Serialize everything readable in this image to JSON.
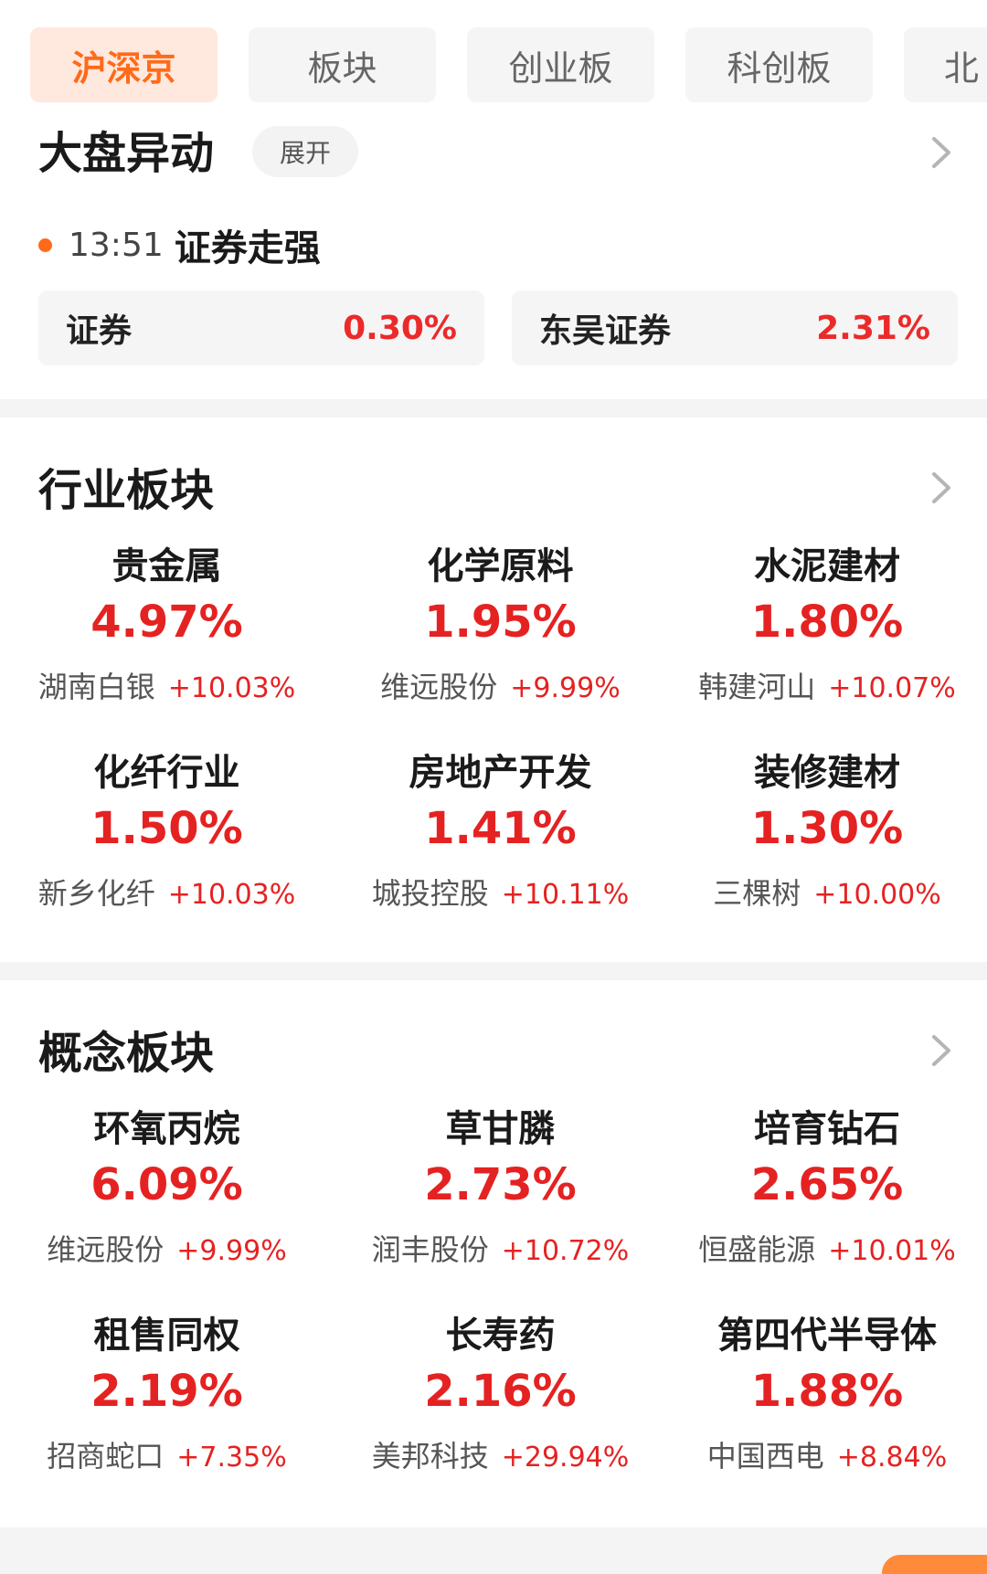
{
  "tabs": [
    {
      "label": "沪深京",
      "active": true
    },
    {
      "label": "板块",
      "active": false
    },
    {
      "label": "创业板",
      "active": false
    },
    {
      "label": "科创板",
      "active": false
    },
    {
      "label": "北",
      "active": false
    }
  ],
  "market_move": {
    "title": "大盘异动",
    "expand_label": "展开",
    "event_time": "13:51",
    "event_text": "证券走强",
    "chips": [
      {
        "name": "证券",
        "value": "0.30%"
      },
      {
        "name": "东吴证券",
        "value": "2.31%"
      }
    ]
  },
  "industry": {
    "title": "行业板块",
    "items": [
      {
        "name": "贵金属",
        "pct": "4.97%",
        "lead": "湖南白银",
        "lead_pct": "+10.03%"
      },
      {
        "name": "化学原料",
        "pct": "1.95%",
        "lead": "维远股份",
        "lead_pct": "+9.99%"
      },
      {
        "name": "水泥建材",
        "pct": "1.80%",
        "lead": "韩建河山",
        "lead_pct": "+10.07%"
      },
      {
        "name": "化纤行业",
        "pct": "1.50%",
        "lead": "新乡化纤",
        "lead_pct": "+10.03%"
      },
      {
        "name": "房地产开发",
        "pct": "1.41%",
        "lead": "城投控股",
        "lead_pct": "+10.11%"
      },
      {
        "name": "装修建材",
        "pct": "1.30%",
        "lead": "三棵树",
        "lead_pct": "+10.00%"
      }
    ]
  },
  "concept": {
    "title": "概念板块",
    "items": [
      {
        "name": "环氧丙烷",
        "pct": "6.09%",
        "lead": "维远股份",
        "lead_pct": "+9.99%"
      },
      {
        "name": "草甘膦",
        "pct": "2.73%",
        "lead": "润丰股份",
        "lead_pct": "+10.72%"
      },
      {
        "name": "培育钻石",
        "pct": "2.65%",
        "lead": "恒盛能源",
        "lead_pct": "+10.01%"
      },
      {
        "name": "租售同权",
        "pct": "2.19%",
        "lead": "招商蛇口",
        "lead_pct": "+7.35%"
      },
      {
        "name": "长寿药",
        "pct": "2.16%",
        "lead": "美邦科技",
        "lead_pct": "+29.94%"
      },
      {
        "name": "第四代半导体",
        "pct": "1.88%",
        "lead": "中国西电",
        "lead_pct": "+8.84%"
      }
    ]
  },
  "colors": {
    "accent": "#ff6a1a",
    "up": "#e52222",
    "tab_bg": "#f5f5f5",
    "tab_active_bg": "#ffe8dd"
  },
  "icons": {
    "chevron": "chevron-right-icon",
    "dot": "orange-dot"
  }
}
